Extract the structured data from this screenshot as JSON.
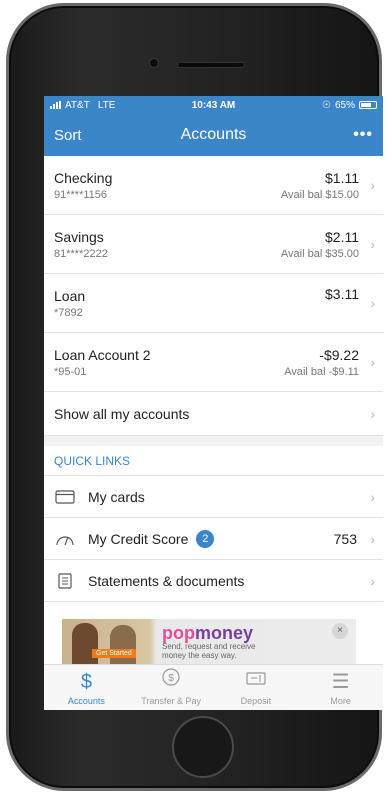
{
  "status": {
    "carrier": "AT&T",
    "network": "LTE",
    "time": "10:43 AM",
    "battery": "65%"
  },
  "nav": {
    "sort_label": "Sort",
    "title": "Accounts",
    "menu_label": "•••"
  },
  "accounts": [
    {
      "name": "Checking",
      "number": "91****1156",
      "balance": "$1.11",
      "available": "Avail bal $15.00"
    },
    {
      "name": "Savings",
      "number": "81****2222",
      "balance": "$2.11",
      "available": "Avail bal $35.00"
    },
    {
      "name": "Loan",
      "number": "*7892",
      "balance": "$3.11",
      "available": ""
    },
    {
      "name": "Loan Account 2",
      "number": "*95-01",
      "balance": "-$9.22",
      "available": "Avail bal -$9.11"
    }
  ],
  "show_all_label": "Show all my accounts",
  "quick_links": {
    "header": "QUICK LINKS",
    "items": [
      {
        "label": "My cards",
        "icon": "card-icon"
      },
      {
        "label": "My Credit Score",
        "icon": "gauge-icon",
        "badge": "2",
        "value": "753"
      },
      {
        "label": "Statements & documents",
        "icon": "document-icon"
      }
    ]
  },
  "ad": {
    "brand_a": "pop",
    "brand_b": "money",
    "tagline_1": "Send, request and receive",
    "tagline_2": "money the easy way.",
    "cta": "Get Started",
    "close": "×"
  },
  "tabs": [
    {
      "label": "Accounts",
      "icon": "dollar-icon",
      "active": true
    },
    {
      "label": "Transfer & Pay",
      "icon": "transfer-icon",
      "active": false
    },
    {
      "label": "Deposit",
      "icon": "deposit-icon",
      "active": false
    },
    {
      "label": "More",
      "icon": "menu-icon",
      "active": false
    }
  ],
  "colors": {
    "primary": "#3a86c8",
    "ad_pink": "#e14f9a",
    "ad_cta": "#f07a1a"
  }
}
